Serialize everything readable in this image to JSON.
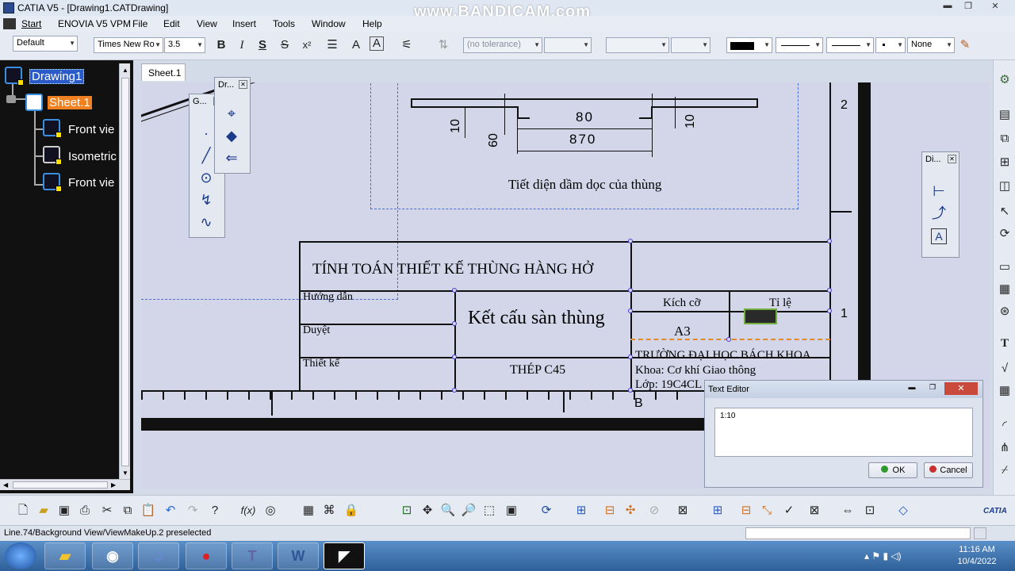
{
  "window": {
    "title": "CATIA V5 - [Drawing1.CATDrawing]",
    "watermark": "www.BANDICAM.com"
  },
  "menubar": [
    "Start",
    "ENOVIA V5 VPM",
    "File",
    "Edit",
    "View",
    "Insert",
    "Tools",
    "Window",
    "Help"
  ],
  "toolbar": {
    "style_value": "Default",
    "font_value": "Times New Ro",
    "font_size_value": "3.5",
    "tolerance_value": "(no tolerance)",
    "line_type_value": "None"
  },
  "tree": {
    "root": "Drawing1",
    "sheet": "Sheet.1",
    "children": [
      "Front vie",
      "Isometric",
      "Front vie"
    ]
  },
  "sheet_tab": "Sheet.1",
  "palettes": {
    "geometry_title": "G...",
    "dress_title": "Dr...",
    "dimension_title": "Di..."
  },
  "drawing": {
    "dims": {
      "d80": "80",
      "d870": "870",
      "d10a": "10",
      "d60": "60",
      "d10b": "10"
    },
    "section_caption": "Tiết diện dầm dọc của thùng",
    "title_block": {
      "main_title": "TÍNH TOÁN THIẾT KẾ THÙNG HÀNG HỞ",
      "row_guide": "Hướng dẫn",
      "row_approve": "Duyệt",
      "row_design": "Thiết kế",
      "part_name": "Kết cấu sàn thùng",
      "material": "THÉP C45",
      "size_label": "Kích cỡ",
      "scale_label": "Tỉ lệ",
      "size_value": "A3",
      "school": "TRƯỜNG ĐẠI HỌC BÁCH KHOA",
      "faculty": "Khoa: Cơ khí Giao thông",
      "class": "Lớp: 19C4CL"
    },
    "border_labels": {
      "two": "2",
      "one": "1",
      "b": "B"
    }
  },
  "text_editor": {
    "title": "Text Editor",
    "content": "1:10",
    "ok": "OK",
    "cancel": "Cancel"
  },
  "status_text": "Line.74/Background View/ViewMakeUp.2 preselected",
  "clock": {
    "time": "11:16 AM",
    "date": "10/4/2022"
  },
  "brand": "CATIA"
}
